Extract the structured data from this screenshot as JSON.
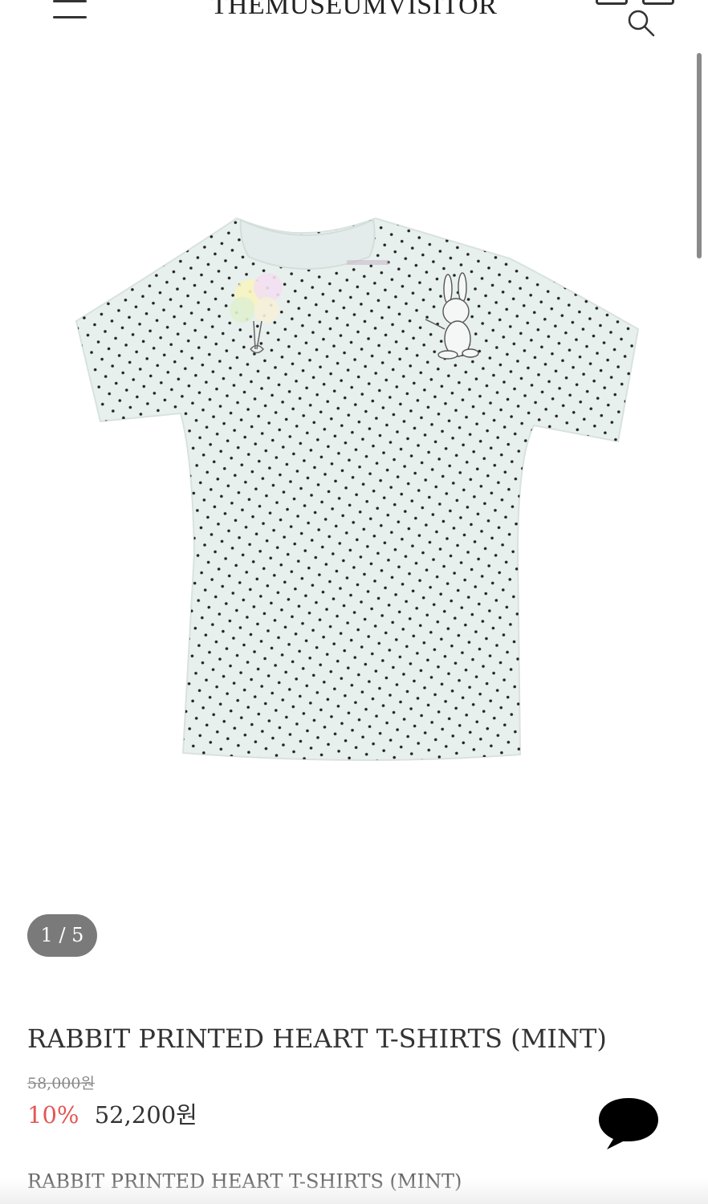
{
  "header": {
    "logo": "THEMUSEUMVISITOR",
    "icons": [
      "menu-icon",
      "my-account-icon",
      "cart-icon",
      "search-icon"
    ]
  },
  "gallery": {
    "counter": "1 / 5",
    "image_icon": "mint-polka-dot-t-shirt-image"
  },
  "product": {
    "title": "RABBIT PRINTED HEART T-SHIRTS (MINT)",
    "original_price": "58,000원",
    "discount": "10%",
    "sale_price": "52,200원",
    "description_title": "RABBIT PRINTED HEART T-SHIRTS (MINT)"
  },
  "colors": {
    "accent_discount": "#e35757",
    "counter_bg": "#7a7a7a",
    "shirt_mint": "#e8f0ee"
  },
  "chat": {
    "icon": "chat-bubble-icon"
  }
}
